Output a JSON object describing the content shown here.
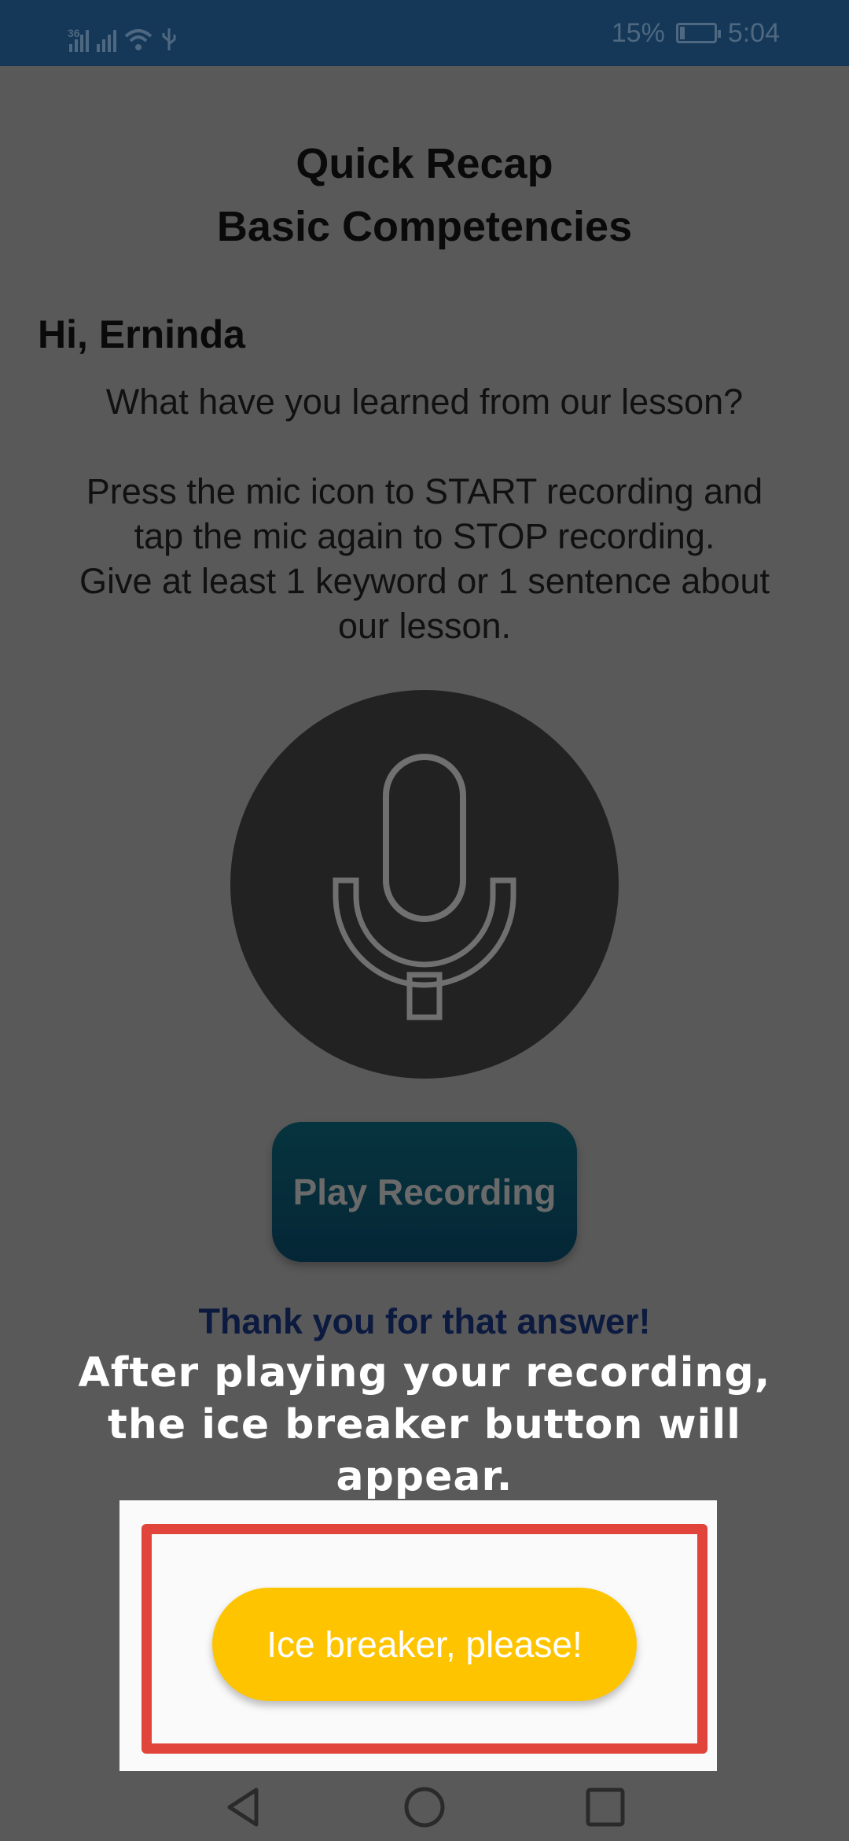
{
  "status_bar": {
    "network_label": "36",
    "battery_percent": "15%",
    "battery_level": 0.15,
    "time": "5:04",
    "icons": [
      "signal-icon",
      "signal-no-sim-icon",
      "wifi-icon",
      "usb-icon",
      "battery-charging-icon"
    ]
  },
  "header": {
    "title_line1": "Quick Recap",
    "title_line2": "Basic Competencies"
  },
  "greeting": "Hi, Erninda",
  "question": "What have you learned from our lesson?",
  "instructions": {
    "line1": "Press the mic icon to START recording and",
    "line2": "tap the mic again to STOP recording.",
    "line3": "Give at least 1 keyword or 1 sentence about",
    "line4": "our lesson."
  },
  "mic_button": {
    "icon": "microphone-icon"
  },
  "play_button": {
    "label": "Play Recording"
  },
  "thanks_text": "Thank you for that answer!",
  "overlay_message": {
    "line1": "After playing your recording,",
    "line2": "the ice breaker button will",
    "line3": "appear."
  },
  "ice_breaker_button": {
    "label": "Ice breaker, please!"
  },
  "colors": {
    "background_dim": "#595959",
    "status_bar": "#163858",
    "highlight_frame": "#e0443b",
    "ice_button": "#ffc400"
  },
  "nav_bar": {
    "icons": [
      "back-icon",
      "home-icon",
      "recents-icon"
    ]
  }
}
